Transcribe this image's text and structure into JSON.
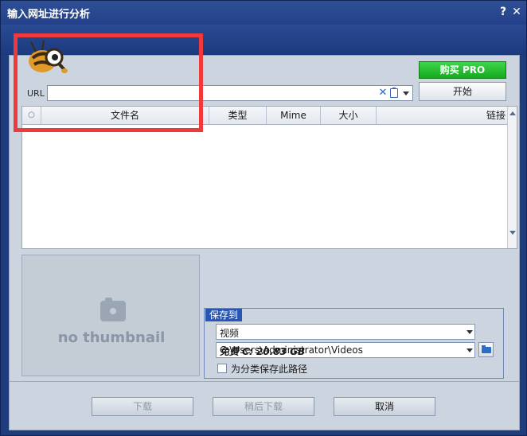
{
  "window": {
    "title": "输入网址进行分析",
    "help_glyph": "?",
    "close_glyph": "✕"
  },
  "toolbar": {
    "buy_label": "购买 PRO",
    "start_label": "开始"
  },
  "url": {
    "label": "URL",
    "value": "",
    "clear_glyph": "✕"
  },
  "table": {
    "columns": [
      "○",
      "文件名",
      "类型",
      "Mime",
      "大小",
      "链接"
    ],
    "rows": []
  },
  "thumbnail": {
    "text": "no thumbnail"
  },
  "save": {
    "title": "保存到",
    "category": "视频",
    "path": "C:\\Users\\Administrator\\Videos",
    "free_space": "免费 C: 20.83 GB",
    "checkbox_label": "为分类保存此路径",
    "checkbox_checked": false
  },
  "buttons": {
    "download": "下载",
    "download_later": "稍后下载",
    "cancel": "取消"
  },
  "colors": {
    "title_bar": "#2a4a92",
    "buy_button": "#16a821",
    "highlight": "#ee3a3a",
    "save_tag": "#2a56b3"
  },
  "icons": [
    "logo-ant-magnifier",
    "clear-icon",
    "paste-icon",
    "dropdown-arrow-icon",
    "camera-icon",
    "folder-icon"
  ]
}
